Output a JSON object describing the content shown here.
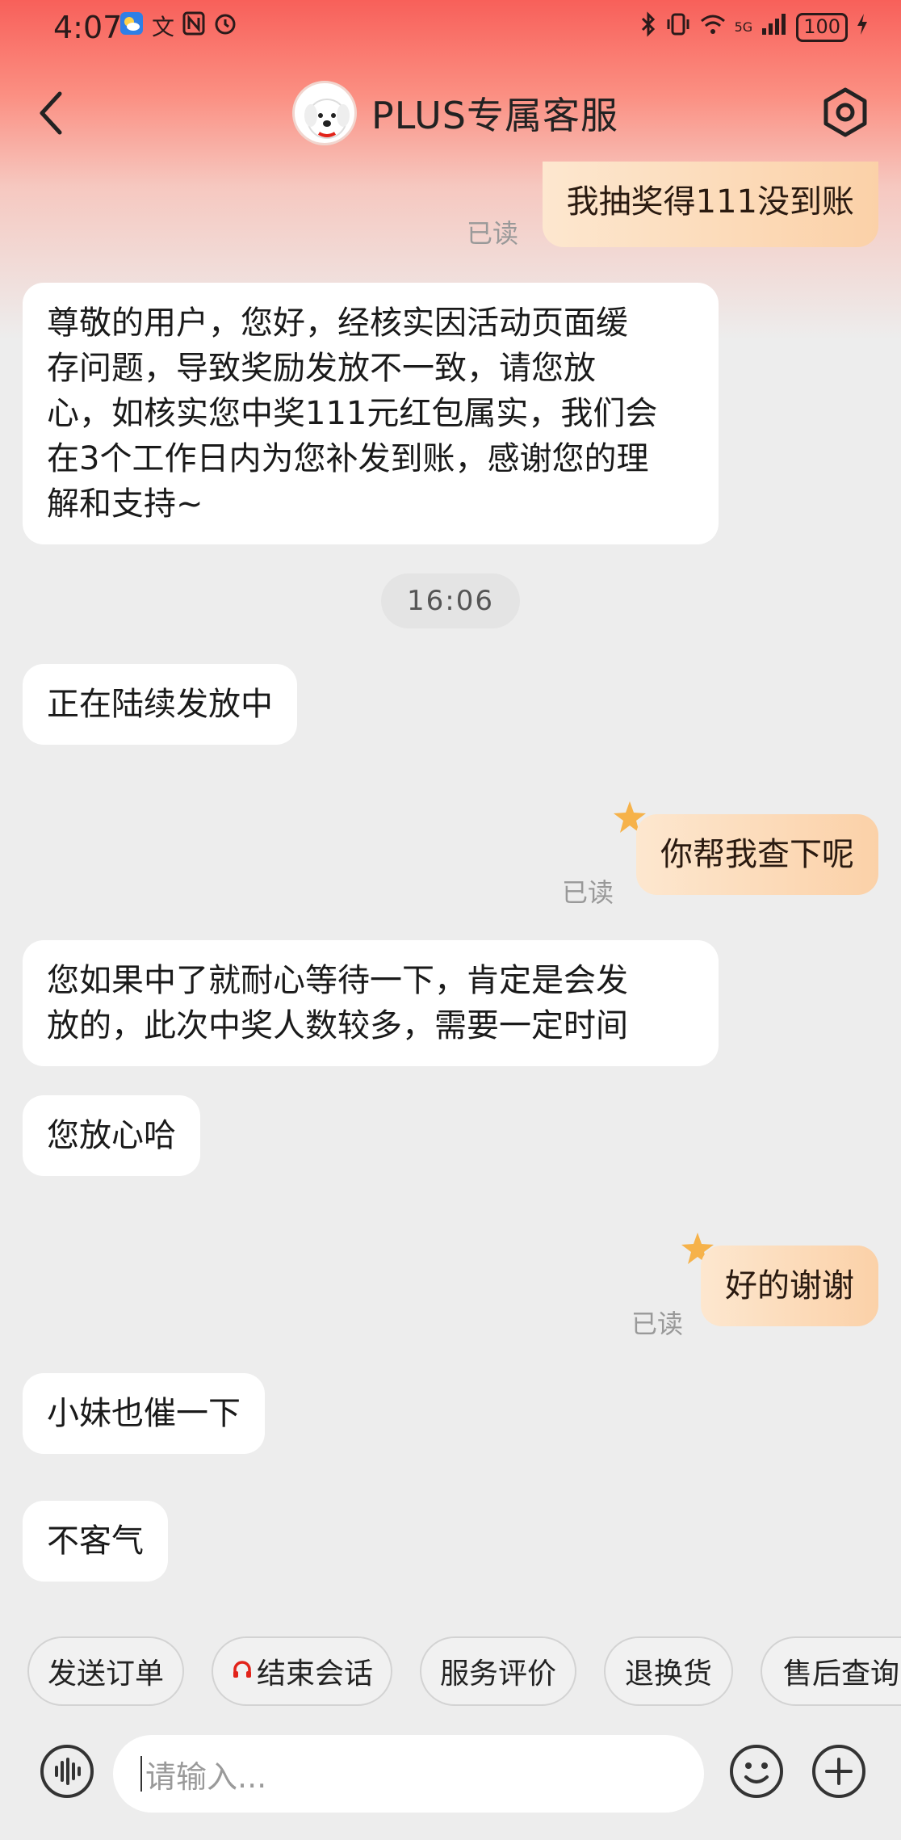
{
  "status_bar": {
    "time": "4:07",
    "icons_left": [
      "weather-icon",
      "translate-icon",
      "nfc-icon",
      "alarm-icon"
    ],
    "icons_right": [
      "bluetooth-icon",
      "vibrate-icon",
      "wifi-icon",
      "signal-icon"
    ],
    "network_label": "5G",
    "battery": "100"
  },
  "header": {
    "title": "PLUS专属客服"
  },
  "messages": [
    {
      "side": "out",
      "text": "我抽奖得111没到账",
      "read": "已读"
    },
    {
      "side": "in",
      "lines": [
        "尊敬的用户，您好，经核实因活动页面缓",
        "存问题，导致奖励发放不一致，请您放",
        "心，如核实您中奖111元红包属实，我们会",
        "在3个工作日内为您补发到账，感谢您的理",
        "解和支持~"
      ]
    },
    {
      "side": "time",
      "text": "16:06"
    },
    {
      "side": "in",
      "text": "正在陆续发放中"
    },
    {
      "side": "out",
      "text": "你帮我查下呢",
      "read": "已读"
    },
    {
      "side": "in",
      "lines": [
        "您如果中了就耐心等待一下，肯定是会发",
        "放的，此次中奖人数较多，需要一定时间"
      ]
    },
    {
      "side": "in",
      "text": "您放心哈"
    },
    {
      "side": "out",
      "text": "好的谢谢",
      "read": "已读"
    },
    {
      "side": "in",
      "text": "小妹也催一下"
    },
    {
      "side": "in",
      "text": "不客气"
    }
  ],
  "quick_actions": [
    "发送订单",
    "结束会话",
    "服务评价",
    "退换货",
    "售后查询"
  ],
  "input": {
    "placeholder": "请输入..."
  },
  "colors": {
    "header_red": "#f8605a",
    "bubble_out": "#fbd1a8",
    "accent_red": "#e2231a"
  }
}
